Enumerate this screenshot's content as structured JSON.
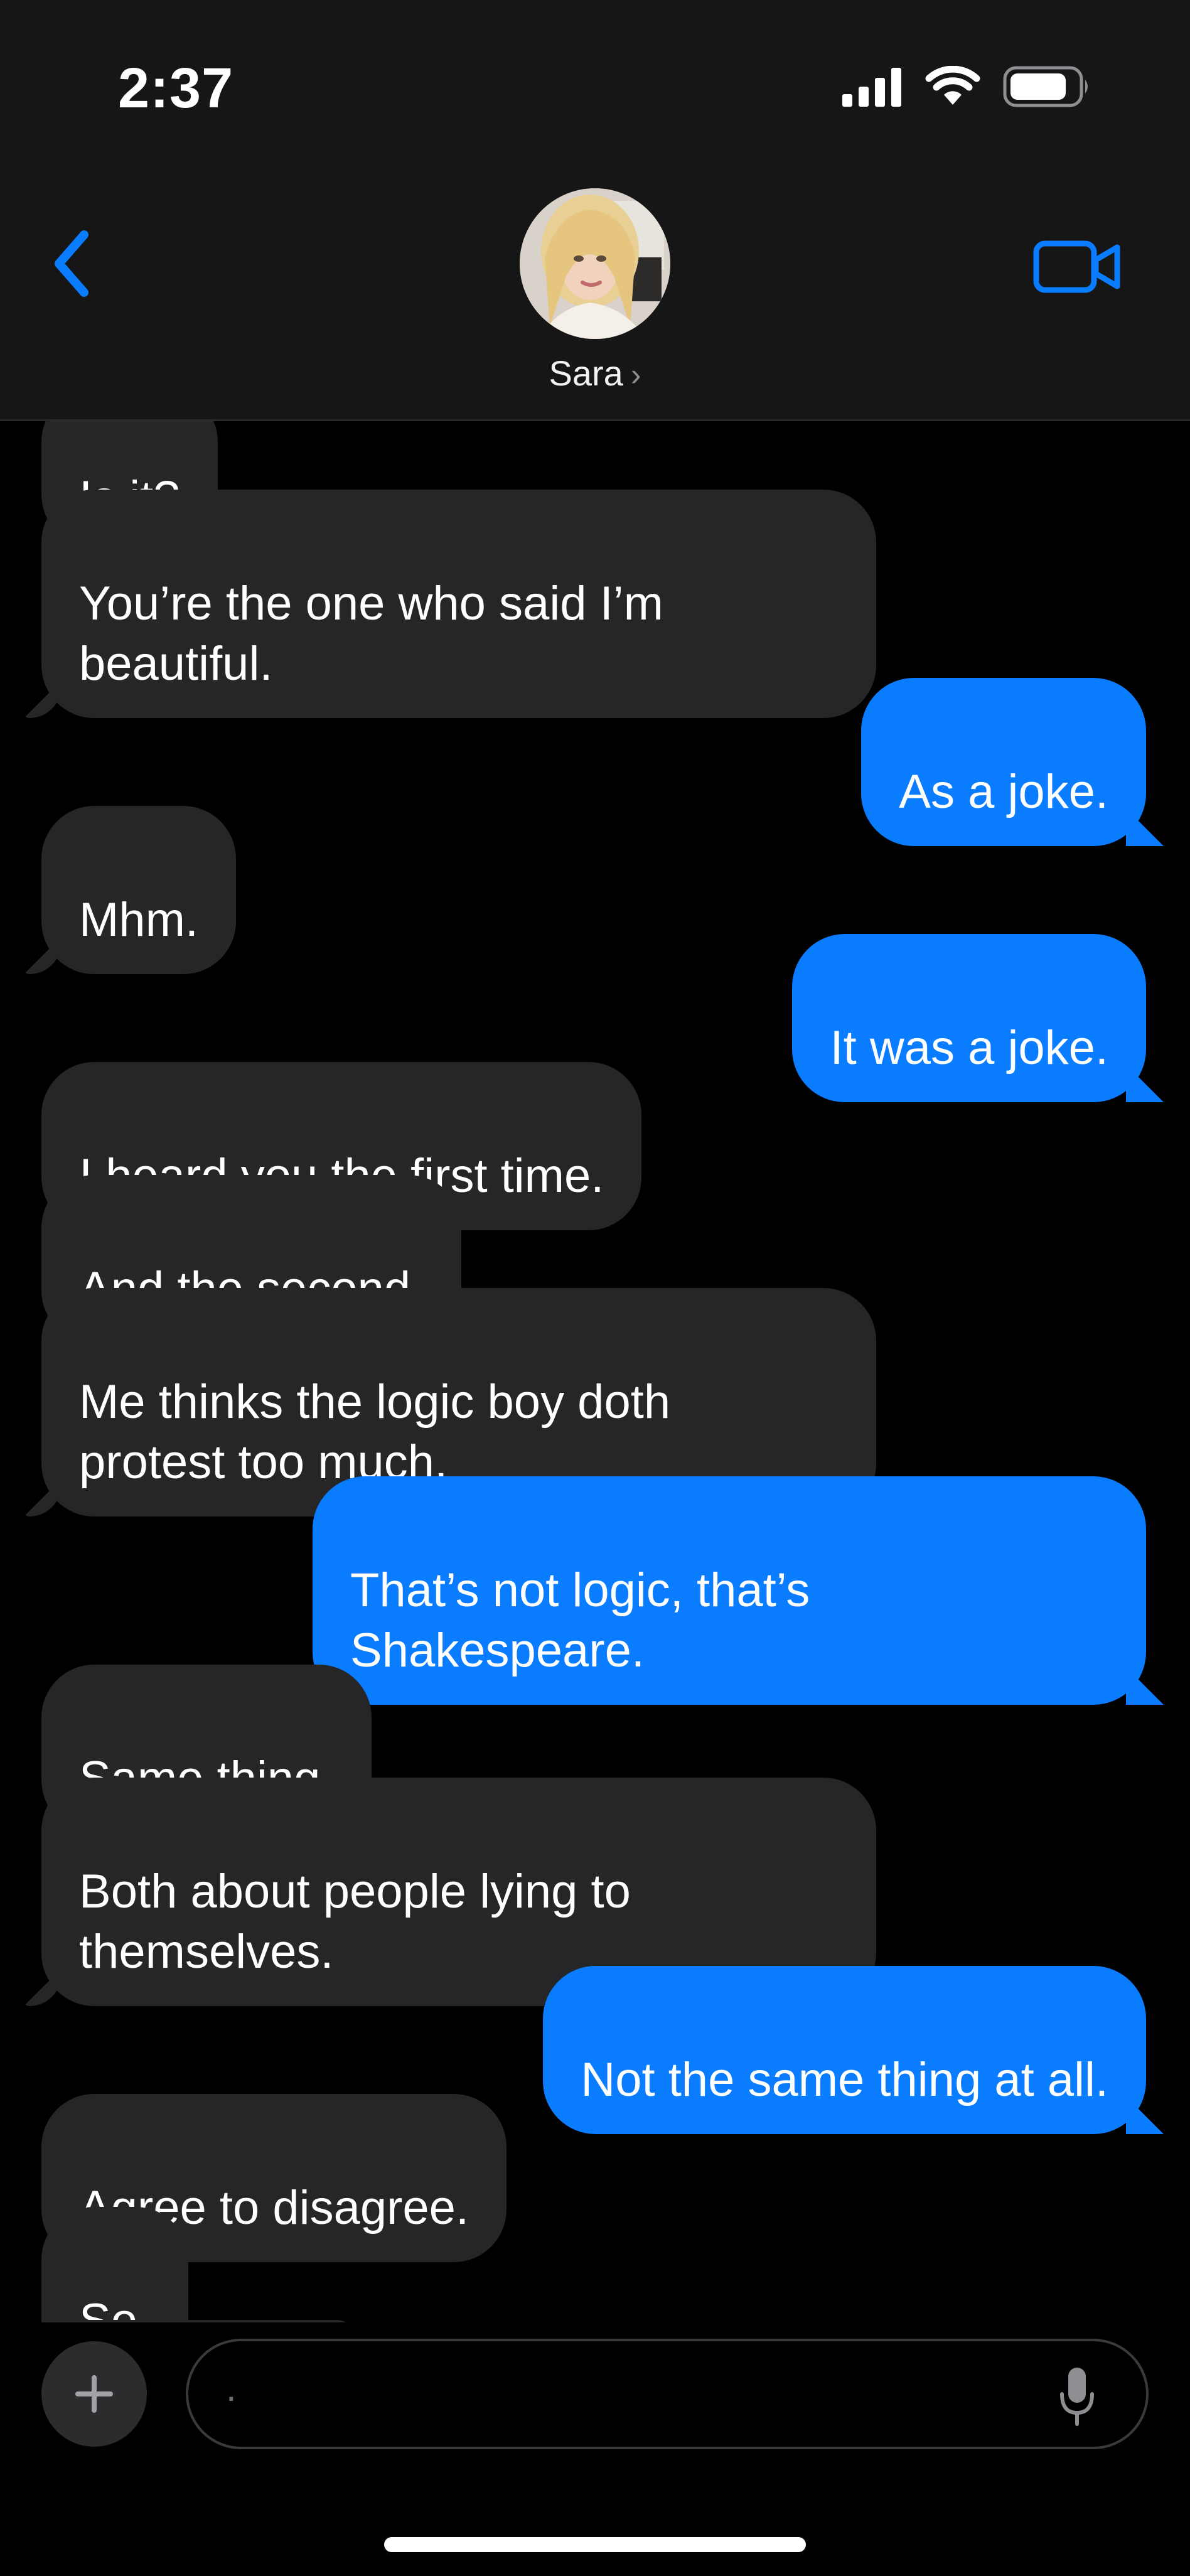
{
  "status_bar": {
    "time": "2:37",
    "signal_icon": "cellular-signal-icon",
    "wifi_icon": "wifi-icon",
    "battery_icon": "battery-icon"
  },
  "header": {
    "back_icon": "chevron-left-icon",
    "contact_name": "Sara",
    "contact_chevron": "›",
    "video_icon": "video-camera-icon",
    "accent_color": "#0a7cff"
  },
  "messages": [
    {
      "from": "them",
      "text": "Is it?"
    },
    {
      "from": "them",
      "text": "You’re the one who said I’m\nbeautiful."
    },
    {
      "from": "me",
      "text": "As a joke."
    },
    {
      "from": "them",
      "text": "Mhm."
    },
    {
      "from": "me",
      "text": "It was a joke."
    },
    {
      "from": "them",
      "text": "I heard you the first time."
    },
    {
      "from": "them",
      "text": "And the second."
    },
    {
      "from": "them",
      "text": "Me thinks the logic boy doth\nprotest too much."
    },
    {
      "from": "me",
      "text": "That’s not logic, that’s\nShakespeare."
    },
    {
      "from": "them",
      "text": "Same thing."
    },
    {
      "from": "them",
      "text": "Both about people lying to\nthemselves."
    },
    {
      "from": "me",
      "text": "Not the same thing at all."
    },
    {
      "from": "them",
      "text": "Agree to disagree."
    },
    {
      "from": "them",
      "text": "So."
    }
  ],
  "composer": {
    "plus_icon": "plus-icon",
    "input_value": ".",
    "mic_icon": "microphone-icon"
  },
  "colors": {
    "incoming_bubble": "#262628",
    "outgoing_bubble": "#0a7cff",
    "background": "#000000"
  }
}
